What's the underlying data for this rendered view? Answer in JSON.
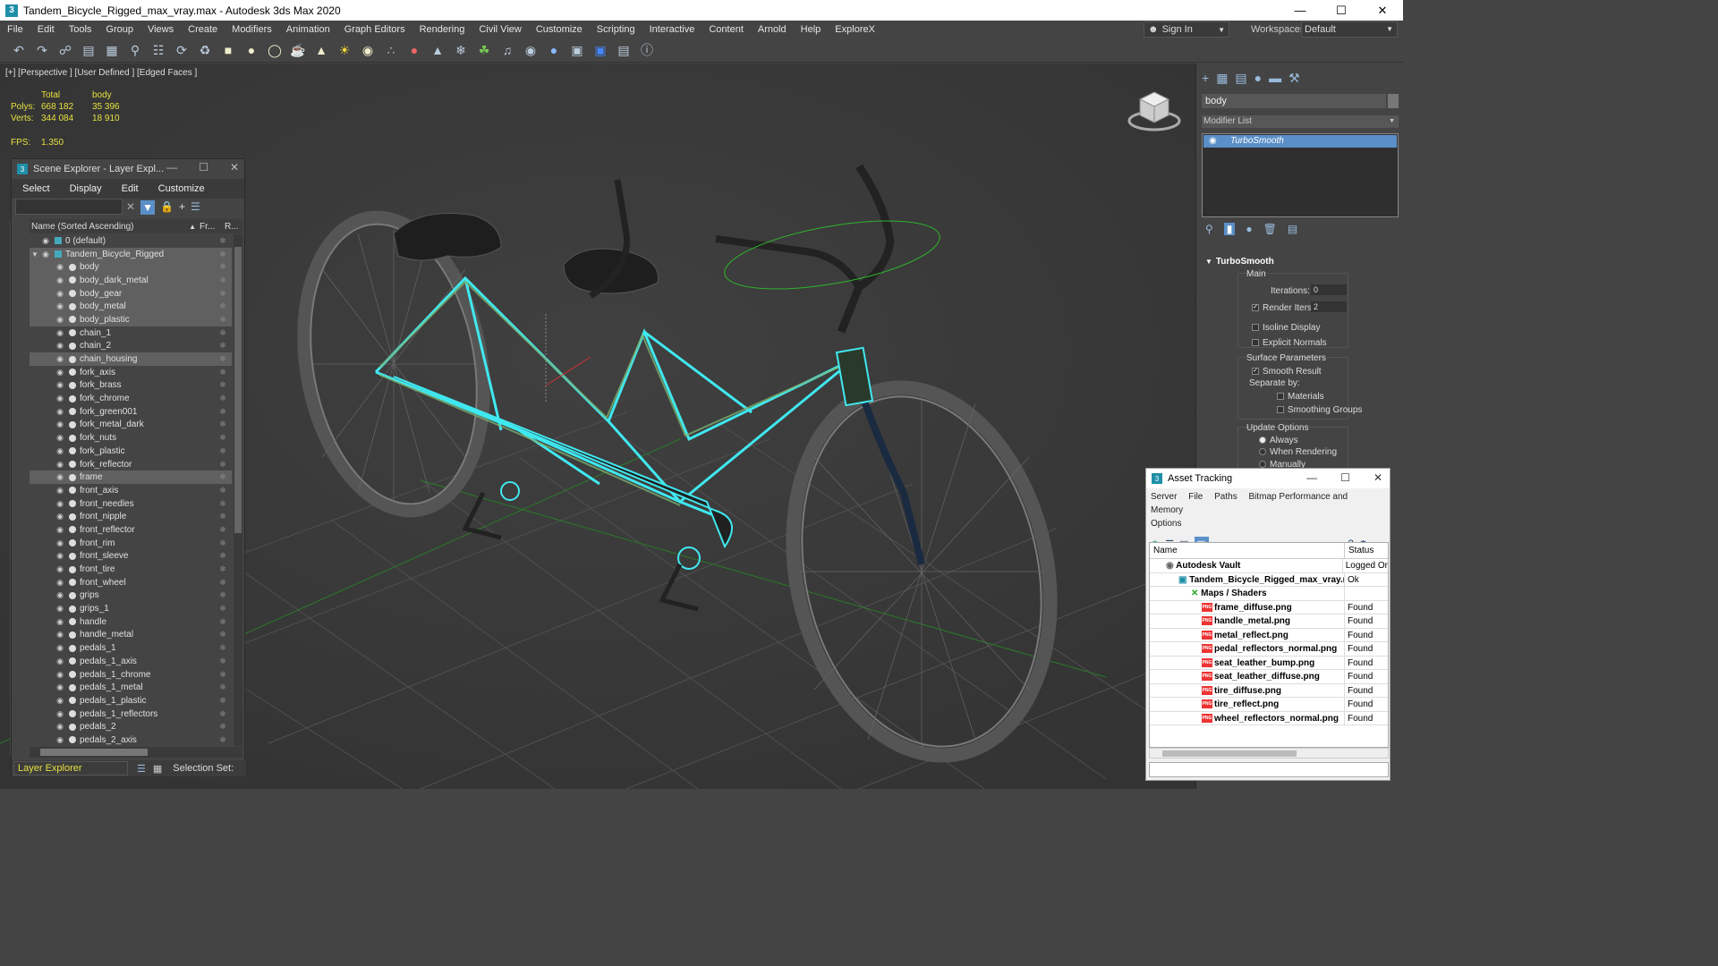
{
  "window": {
    "title": "Tandem_Bicycle_Rigged_max_vray.max - Autodesk 3ds Max 2020"
  },
  "menu": [
    "File",
    "Edit",
    "Tools",
    "Group",
    "Views",
    "Create",
    "Modifiers",
    "Animation",
    "Graph Editors",
    "Rendering",
    "Civil View",
    "Customize",
    "Scripting",
    "Interactive",
    "Content",
    "Arnold",
    "Help",
    "ExploreX"
  ],
  "account": {
    "sign_in": "Sign In",
    "workspaces_label": "Workspaces:",
    "workspace": "Default"
  },
  "viewport": {
    "label": "[+] [Perspective ] [User Defined ] [Edged Faces ]",
    "stats": {
      "total_label": "Total",
      "obj_label": "body",
      "polys_label": "Polys:",
      "polys_total": "668 182",
      "polys_obj": "35 396",
      "verts_label": "Verts:",
      "verts_total": "344 084",
      "verts_obj": "18 910",
      "fps_label": "FPS:",
      "fps": "1.350"
    }
  },
  "scene_explorer": {
    "title": "Scene Explorer - Layer Expl...",
    "menu": [
      "Select",
      "Display",
      "Edit",
      "Customize"
    ],
    "col_name": "Name (Sorted Ascending)",
    "col_frozen": "Fr...",
    "col_render": "R...",
    "rows": [
      {
        "name": "0 (default)",
        "level": 0,
        "sel": false
      },
      {
        "name": "Tandem_Bicycle_Rigged",
        "level": 0,
        "sel": true
      },
      {
        "name": "body",
        "level": 1,
        "sel": true
      },
      {
        "name": "body_dark_metal",
        "level": 1,
        "sel": true
      },
      {
        "name": "body_gear",
        "level": 1,
        "sel": true
      },
      {
        "name": "body_metal",
        "level": 1,
        "sel": true
      },
      {
        "name": "body_plastic",
        "level": 1,
        "sel": true
      },
      {
        "name": "chain_1",
        "level": 1,
        "sel": false
      },
      {
        "name": "chain_2",
        "level": 1,
        "sel": false
      },
      {
        "name": "chain_housing",
        "level": 1,
        "sel": true
      },
      {
        "name": "fork_axis",
        "level": 1,
        "sel": false
      },
      {
        "name": "fork_brass",
        "level": 1,
        "sel": false
      },
      {
        "name": "fork_chrome",
        "level": 1,
        "sel": false
      },
      {
        "name": "fork_green001",
        "level": 1,
        "sel": false
      },
      {
        "name": "fork_metal_dark",
        "level": 1,
        "sel": false
      },
      {
        "name": "fork_nuts",
        "level": 1,
        "sel": false
      },
      {
        "name": "fork_plastic",
        "level": 1,
        "sel": false
      },
      {
        "name": "fork_reflector",
        "level": 1,
        "sel": false
      },
      {
        "name": "frame",
        "level": 1,
        "sel": true
      },
      {
        "name": "front_axis",
        "level": 1,
        "sel": false
      },
      {
        "name": "front_needles",
        "level": 1,
        "sel": false
      },
      {
        "name": "front_nipple",
        "level": 1,
        "sel": false
      },
      {
        "name": "front_reflector",
        "level": 1,
        "sel": false
      },
      {
        "name": "front_rim",
        "level": 1,
        "sel": false
      },
      {
        "name": "front_sleeve",
        "level": 1,
        "sel": false
      },
      {
        "name": "front_tire",
        "level": 1,
        "sel": false
      },
      {
        "name": "front_wheel",
        "level": 1,
        "sel": false
      },
      {
        "name": "grips",
        "level": 1,
        "sel": false
      },
      {
        "name": "grips_1",
        "level": 1,
        "sel": false
      },
      {
        "name": "handle",
        "level": 1,
        "sel": false
      },
      {
        "name": "handle_metal",
        "level": 1,
        "sel": false
      },
      {
        "name": "pedals_1",
        "level": 1,
        "sel": false
      },
      {
        "name": "pedals_1_axis",
        "level": 1,
        "sel": false
      },
      {
        "name": "pedals_1_chrome",
        "level": 1,
        "sel": false
      },
      {
        "name": "pedals_1_metal",
        "level": 1,
        "sel": false
      },
      {
        "name": "pedals_1_plastic",
        "level": 1,
        "sel": false
      },
      {
        "name": "pedals_1_reflectors",
        "level": 1,
        "sel": false
      },
      {
        "name": "pedals_2",
        "level": 1,
        "sel": false
      },
      {
        "name": "pedals_2_axis",
        "level": 1,
        "sel": false
      }
    ],
    "footer_mode": "Layer Explorer",
    "selection_set_label": "Selection Set:"
  },
  "command_panel": {
    "object_name": "body",
    "modifier_list": "Modifier List",
    "stack_item": "TurboSmooth",
    "rollout_title": "TurboSmooth",
    "main_label": "Main",
    "iterations_label": "Iterations:",
    "iterations": "0",
    "render_iters_label": "Render Iters:",
    "render_iters": "2",
    "isoline": "Isoline Display",
    "explicit_normals": "Explicit Normals",
    "surface_params": "Surface Parameters",
    "smooth_result": "Smooth Result",
    "separate_by": "Separate by:",
    "materials": "Materials",
    "smoothing_groups": "Smoothing Groups",
    "update_options": "Update Options",
    "always": "Always",
    "when_rendering": "When Rendering",
    "manually": "Manually"
  },
  "asset_tracking": {
    "title": "Asset Tracking",
    "menu": [
      "Server",
      "File",
      "Paths",
      "Bitmap Performance and Memory",
      "Options"
    ],
    "col_name": "Name",
    "col_status": "Status",
    "rows": [
      {
        "name": "Autodesk Vault",
        "status": "Logged Or",
        "indent": 18,
        "icon": "vault"
      },
      {
        "name": "Tandem_Bicycle_Rigged_max_vray.max",
        "status": "Ok",
        "indent": 32,
        "icon": "max"
      },
      {
        "name": "Maps / Shaders",
        "status": "",
        "indent": 46,
        "icon": "maps"
      },
      {
        "name": "frame_diffuse.png",
        "status": "Found",
        "indent": 58,
        "icon": "png"
      },
      {
        "name": "handle_metal.png",
        "status": "Found",
        "indent": 58,
        "icon": "png"
      },
      {
        "name": "metal_reflect.png",
        "status": "Found",
        "indent": 58,
        "icon": "png"
      },
      {
        "name": "pedal_reflectors_normal.png",
        "status": "Found",
        "indent": 58,
        "icon": "png"
      },
      {
        "name": "seat_leather_bump.png",
        "status": "Found",
        "indent": 58,
        "icon": "png"
      },
      {
        "name": "seat_leather_diffuse.png",
        "status": "Found",
        "indent": 58,
        "icon": "png"
      },
      {
        "name": "tire_diffuse.png",
        "status": "Found",
        "indent": 58,
        "icon": "png"
      },
      {
        "name": "tire_reflect.png",
        "status": "Found",
        "indent": 58,
        "icon": "png"
      },
      {
        "name": "wheel_reflectors_normal.png",
        "status": "Found",
        "indent": 58,
        "icon": "png"
      }
    ]
  },
  "colors": {
    "selection_cyan": "#40e8f0",
    "accent_blue": "#5a8fc8",
    "stats_yellow": "#e6e040"
  }
}
